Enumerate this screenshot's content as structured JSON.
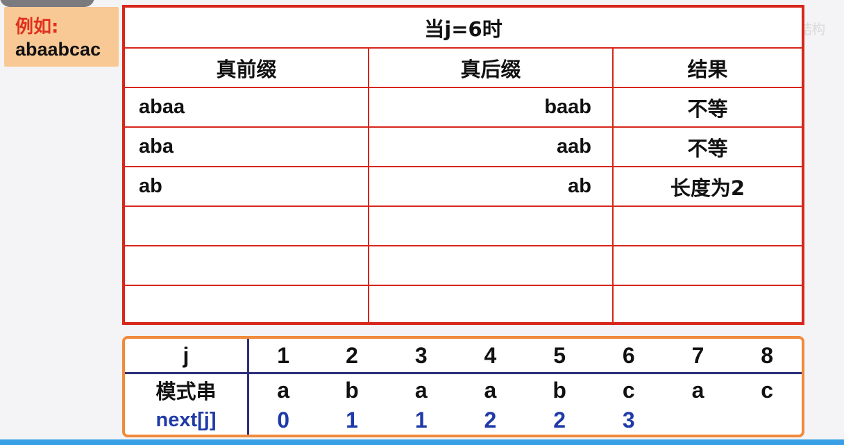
{
  "example": {
    "label": "例如:",
    "value": "abaabcac"
  },
  "watermark": "lh数据结构",
  "table": {
    "title": "当j=6时",
    "headers": [
      "真前缀",
      "真后缀",
      "结果"
    ],
    "rows": [
      {
        "prefix": "abaa",
        "suffix": "baab",
        "result": "不等"
      },
      {
        "prefix": "aba",
        "suffix": "aab",
        "result": "不等"
      },
      {
        "prefix": "ab",
        "suffix": "ab",
        "result": "长度为2"
      },
      {
        "prefix": "",
        "suffix": "",
        "result": ""
      },
      {
        "prefix": "",
        "suffix": "",
        "result": ""
      },
      {
        "prefix": "",
        "suffix": "",
        "result": ""
      }
    ]
  },
  "next_table": {
    "j_label": "j",
    "pattern_label": "模式串",
    "next_label": "next[j]",
    "j": [
      "1",
      "2",
      "3",
      "4",
      "5",
      "6",
      "7",
      "8"
    ],
    "pattern": [
      "a",
      "b",
      "a",
      "a",
      "b",
      "c",
      "a",
      "c"
    ],
    "next": [
      "0",
      "1",
      "1",
      "2",
      "2",
      "3",
      "",
      ""
    ]
  },
  "colors": {
    "red_border": "#d7261b",
    "orange_border": "#f08a3c",
    "blue_text": "#1f3aa8",
    "label_red": "#e0301e"
  }
}
